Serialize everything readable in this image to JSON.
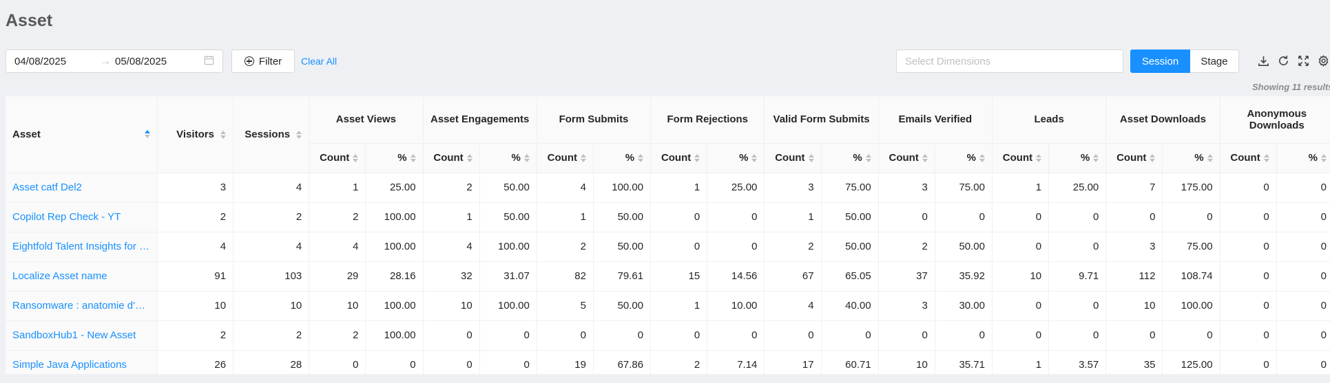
{
  "page": {
    "title": "Asset"
  },
  "filters": {
    "start_date": "04/08/2025",
    "end_date": "05/08/2025",
    "filter_label": "Filter",
    "clear_label": "Clear All",
    "dimensions_placeholder": "Select Dimensions"
  },
  "view_toggle": {
    "session_label": "Session",
    "stage_label": "Stage",
    "active": "Session"
  },
  "toolbar_icons": [
    "download-icon",
    "refresh-icon",
    "fullscreen-icon",
    "settings-icon"
  ],
  "result_text": "Showing 11 results",
  "table": {
    "columns": {
      "asset": "Asset",
      "visitors": "Visitors",
      "sessions": "Sessions",
      "groups": [
        "Asset Views",
        "Asset Engagements",
        "Form Submits",
        "Form Rejections",
        "Valid Form Submits",
        "Emails Verified",
        "Leads",
        "Asset Downloads",
        "Anonymous Downloads"
      ],
      "count_label": "Count",
      "pct_label": "%"
    },
    "rows": [
      {
        "asset": "Asset catf Del2",
        "visitors": "3",
        "sessions": "4",
        "metrics": [
          "1",
          "25.00",
          "2",
          "50.00",
          "4",
          "100.00",
          "1",
          "25.00",
          "3",
          "75.00",
          "3",
          "75.00",
          "1",
          "25.00",
          "7",
          "175.00",
          "0",
          "0"
        ]
      },
      {
        "asset": "Copilot Rep Check - YT",
        "visitors": "2",
        "sessions": "2",
        "metrics": [
          "2",
          "100.00",
          "1",
          "50.00",
          "1",
          "50.00",
          "0",
          "0",
          "1",
          "50.00",
          "0",
          "0",
          "0",
          "0",
          "0",
          "0",
          "0",
          "0"
        ]
      },
      {
        "asset": "Eightfold Talent Insights for …",
        "visitors": "4",
        "sessions": "4",
        "metrics": [
          "4",
          "100.00",
          "4",
          "100.00",
          "2",
          "50.00",
          "0",
          "0",
          "2",
          "50.00",
          "2",
          "50.00",
          "0",
          "0",
          "3",
          "75.00",
          "0",
          "0"
        ]
      },
      {
        "asset": "Localize Asset name",
        "visitors": "91",
        "sessions": "103",
        "metrics": [
          "29",
          "28.16",
          "32",
          "31.07",
          "82",
          "79.61",
          "15",
          "14.56",
          "67",
          "65.05",
          "37",
          "35.92",
          "10",
          "9.71",
          "112",
          "108.74",
          "0",
          "0"
        ]
      },
      {
        "asset": "Ransomware : anatomie d'u…",
        "visitors": "10",
        "sessions": "10",
        "metrics": [
          "10",
          "100.00",
          "10",
          "100.00",
          "5",
          "50.00",
          "1",
          "10.00",
          "4",
          "40.00",
          "3",
          "30.00",
          "0",
          "0",
          "10",
          "100.00",
          "0",
          "0"
        ]
      },
      {
        "asset": "SandboxHub1 - New Asset",
        "visitors": "2",
        "sessions": "2",
        "metrics": [
          "2",
          "100.00",
          "0",
          "0",
          "0",
          "0",
          "0",
          "0",
          "0",
          "0",
          "0",
          "0",
          "0",
          "0",
          "0",
          "0",
          "0",
          "0"
        ]
      },
      {
        "asset": "Simple Java Applications",
        "visitors": "26",
        "sessions": "28",
        "metrics": [
          "0",
          "0",
          "0",
          "0",
          "19",
          "67.86",
          "2",
          "7.14",
          "17",
          "60.71",
          "10",
          "35.71",
          "1",
          "3.57",
          "35",
          "125.00",
          "0",
          "0"
        ]
      }
    ]
  }
}
